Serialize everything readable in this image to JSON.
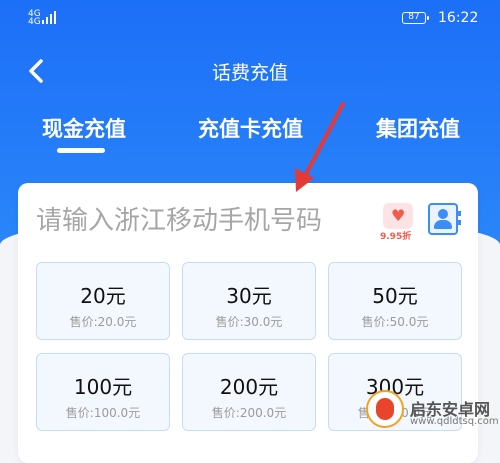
{
  "status_bar": {
    "signal_top": "4G",
    "signal_bottom": "4G",
    "battery": "87",
    "time": "16:22"
  },
  "header": {
    "title": "话费充值"
  },
  "tabs": [
    {
      "label": "现金充值",
      "active": true
    },
    {
      "label": "充值卡充值",
      "active": false
    },
    {
      "label": "集团充值",
      "active": false
    }
  ],
  "phone": {
    "placeholder": "请输入浙江移动手机号码",
    "value": ""
  },
  "discount_badge": "9.95折",
  "amounts": [
    {
      "value": "20元",
      "price": "售价:20.0元"
    },
    {
      "value": "30元",
      "price": "售价:30.0元"
    },
    {
      "value": "50元",
      "price": "售价:50.0元"
    },
    {
      "value": "100元",
      "price": "售价:100.0元"
    },
    {
      "value": "200元",
      "price": "售价:200.0元"
    },
    {
      "value": "300元",
      "price": "售价:300.0元"
    }
  ],
  "watermark": {
    "name": "启东安卓网",
    "url": "www.qdldtsq.com"
  },
  "colors": {
    "primary": "#1c6ff7",
    "accent_red": "#f25a4a",
    "card_border": "#c7ddf6"
  },
  "icons": {
    "back": "chevron-left-icon",
    "contact": "contact-book-icon",
    "discount": "heart-icon"
  }
}
